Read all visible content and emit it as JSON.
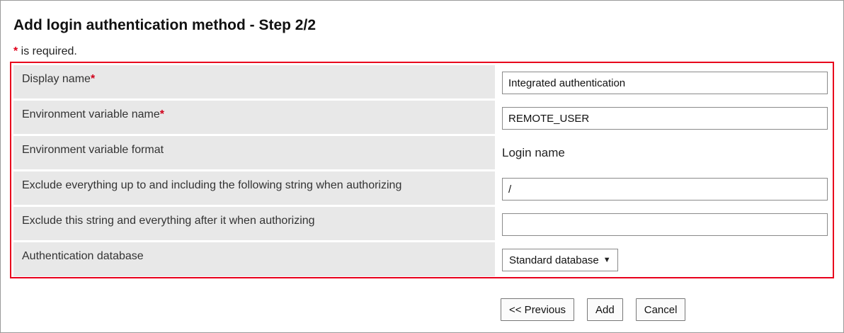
{
  "page": {
    "title": "Add login authentication method - Step 2/2",
    "required_star": "*",
    "required_text": " is required."
  },
  "form": {
    "rows": [
      {
        "label": "Display name",
        "required": "*",
        "value": "Integrated authentication"
      },
      {
        "label": "Environment variable name",
        "required": "*",
        "value": "REMOTE_USER"
      },
      {
        "label": "Environment variable format",
        "value": "Login name"
      },
      {
        "label": "Exclude everything up to and including the following string when authorizing",
        "value": "/"
      },
      {
        "label": "Exclude this string and everything after it when authorizing",
        "value": ""
      },
      {
        "label": "Authentication database",
        "value": "Standard database"
      }
    ]
  },
  "select_caret_icon": "triangle-down-icon",
  "buttons": {
    "previous": "<< Previous",
    "add": "Add",
    "cancel": "Cancel"
  },
  "colors": {
    "required_red": "#e0001a",
    "highlight_border": "#e8001c",
    "label_background": "#e8e8e8"
  }
}
